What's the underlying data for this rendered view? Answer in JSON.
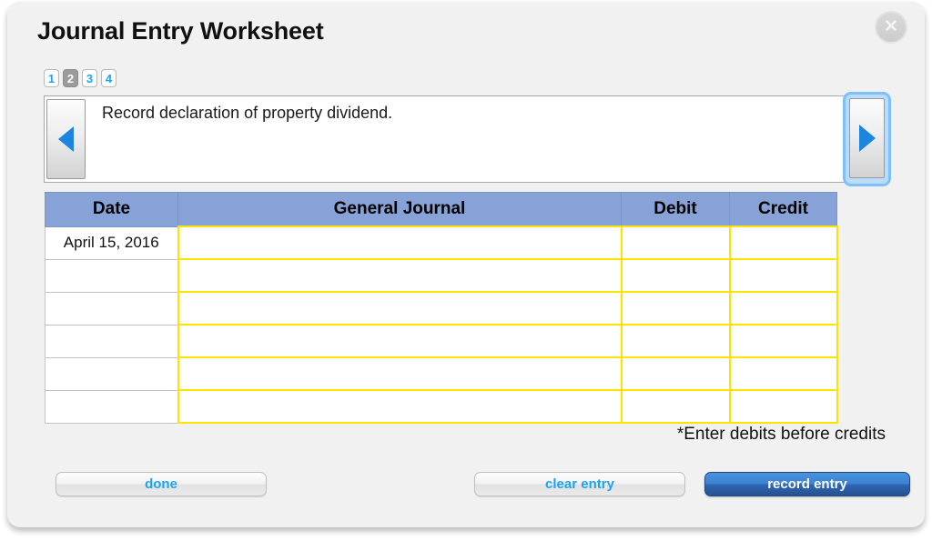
{
  "dialog": {
    "title": "Journal Entry Worksheet",
    "close_icon": "close-x-icon"
  },
  "page_tabs": {
    "items": [
      {
        "label": "1",
        "active": false
      },
      {
        "label": "2",
        "active": true
      },
      {
        "label": "3",
        "active": false
      },
      {
        "label": "4",
        "active": false
      }
    ]
  },
  "instruction": {
    "text": "Record declaration of property dividend.",
    "prev_icon": "triangle-left-icon",
    "next_icon": "triangle-right-icon"
  },
  "table": {
    "headers": [
      "Date",
      "General Journal",
      "Debit",
      "Credit"
    ],
    "rows": [
      {
        "date": "April 15, 2016",
        "general_journal": "",
        "debit": "",
        "credit": ""
      },
      {
        "date": "",
        "general_journal": "",
        "debit": "",
        "credit": ""
      },
      {
        "date": "",
        "general_journal": "",
        "debit": "",
        "credit": ""
      },
      {
        "date": "",
        "general_journal": "",
        "debit": "",
        "credit": ""
      },
      {
        "date": "",
        "general_journal": "",
        "debit": "",
        "credit": ""
      },
      {
        "date": "",
        "general_journal": "",
        "debit": "",
        "credit": ""
      }
    ]
  },
  "note": "*Enter debits before credits",
  "footer": {
    "done_label": "done",
    "clear_label": "clear entry",
    "record_label": "record entry"
  },
  "colors": {
    "header_blue": "#86a2d6",
    "input_yellow": "#ffe400",
    "accent_blue": "#1ca4ef",
    "primary_blue": "#3c82d2",
    "arrow_blue": "#1b85e0"
  }
}
